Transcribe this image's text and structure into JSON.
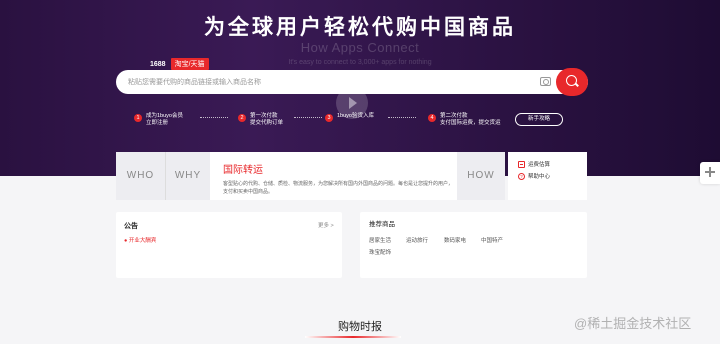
{
  "hero": {
    "title": "为全球用户轻松代购中国商品",
    "watermark_title": "How Apps Connect",
    "watermark_sub": "It's easy to connect to 3,000+ apps for nothing"
  },
  "search": {
    "source_tab_1688": "1688",
    "source_tab_taobao": "淘宝/天猫",
    "placeholder": "粘贴您需要代购的商品链接或输入商品名称"
  },
  "steps": [
    {
      "num": "1",
      "line1": "成为1buyo会员",
      "line2": "立即注册"
    },
    {
      "num": "2",
      "line1": "第一次付款",
      "line2": "提交代购订单"
    },
    {
      "num": "3",
      "line1": "1buyo验货入库",
      "line2": ""
    },
    {
      "num": "4",
      "line1": "第二次付款",
      "line2": "支付国际运费，提交货运"
    }
  ],
  "guide_button": "新手攻略",
  "info": {
    "who": "WHO",
    "why": "WHY",
    "how": "HOW",
    "intl_title": "国际转运",
    "intl_desc": "客型贴心的代购、仓储、质检、物流服务，为您解决所有国内外国商品的问题。每也是让您提升的用户，支付和买卖中国商品。"
  },
  "side_links": {
    "fees": "运费估算",
    "help": "帮助中心"
  },
  "notice": {
    "title": "公告",
    "more": "更多 >",
    "items": [
      "● 开业大酬宾"
    ]
  },
  "reco": {
    "title": "推荐商品",
    "categories": [
      "居家生活",
      "运动旅行",
      "数码家电",
      "中国特产",
      "珠宝配饰"
    ]
  },
  "bottom": {
    "section_title": "购物时报",
    "site_watermark": "@稀土掘金技术社区"
  }
}
